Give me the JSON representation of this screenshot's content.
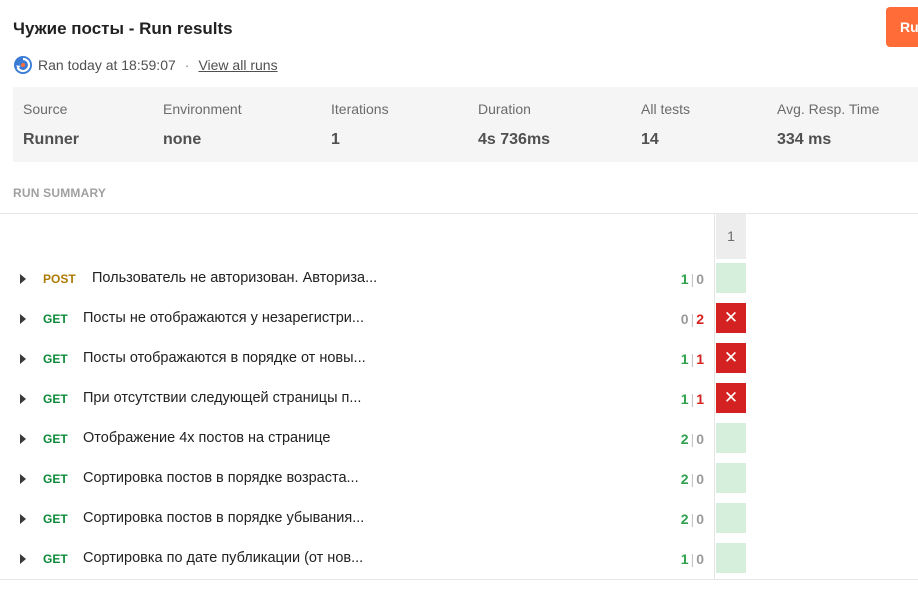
{
  "header": {
    "title": "Чужие посты - Run results",
    "run_button_label": "Ru",
    "ran_text": "Ran today at 18:59:07",
    "separator": "·",
    "view_all_label": "View all runs"
  },
  "stats": {
    "source": {
      "label": "Source",
      "value": "Runner"
    },
    "environment": {
      "label": "Environment",
      "value": "none"
    },
    "iterations": {
      "label": "Iterations",
      "value": "1"
    },
    "duration": {
      "label": "Duration",
      "value": "4s 736ms"
    },
    "all_tests": {
      "label": "All tests",
      "value": "14"
    },
    "avg_resp": {
      "label": "Avg. Resp. Time",
      "value": "334 ms"
    }
  },
  "summary": {
    "section_label": "RUN SUMMARY",
    "iteration_header": "1",
    "fail_icon": "✕",
    "requests": [
      {
        "method": "POST",
        "name": "Пользователь не авторизован. Авториза...",
        "passed": "1",
        "failed": "0",
        "status": "pass"
      },
      {
        "method": "GET",
        "name": "Посты не отображаются у незарегистри...",
        "passed": "0",
        "failed": "2",
        "status": "fail"
      },
      {
        "method": "GET",
        "name": "Посты отображаются в порядке от новы...",
        "passed": "1",
        "failed": "1",
        "status": "fail"
      },
      {
        "method": "GET",
        "name": "При отсутствии следующей страницы п...",
        "passed": "1",
        "failed": "1",
        "status": "fail"
      },
      {
        "method": "GET",
        "name": "Отображение 4х постов на странице",
        "passed": "2",
        "failed": "0",
        "status": "pass"
      },
      {
        "method": "GET",
        "name": "Сортировка постов в порядке возраста...",
        "passed": "2",
        "failed": "0",
        "status": "pass"
      },
      {
        "method": "GET",
        "name": "Сортировка постов в порядке убывания...",
        "passed": "2",
        "failed": "0",
        "status": "pass"
      },
      {
        "method": "GET",
        "name": "Сортировка по дате публикации (от нов...",
        "passed": "1",
        "failed": "0",
        "status": "pass"
      }
    ]
  },
  "colors": {
    "accent": "#ff6c37",
    "pass": "#2fa04b",
    "fail": "#d42121",
    "get": "#0b8a37",
    "post": "#ad7a03"
  }
}
